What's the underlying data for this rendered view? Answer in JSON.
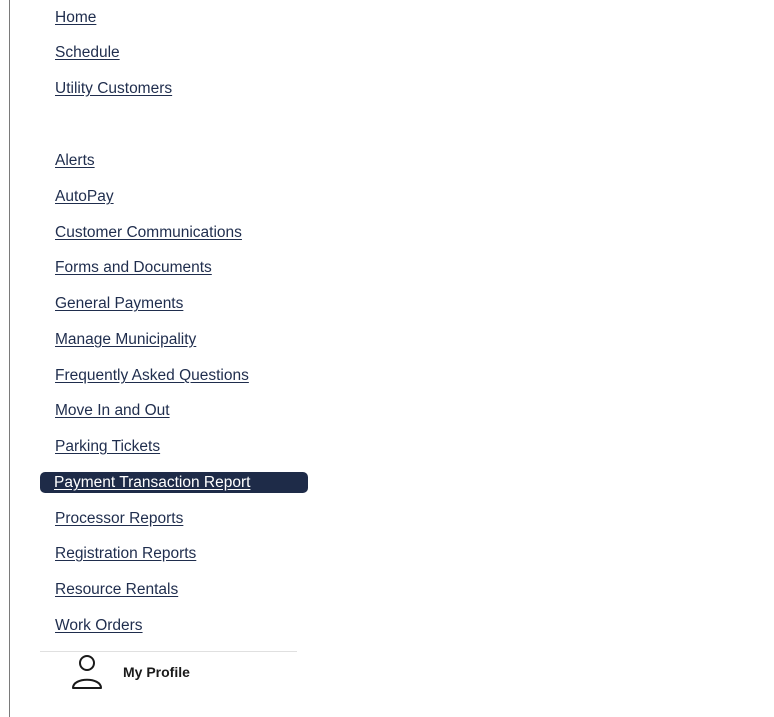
{
  "nav": {
    "items": [
      {
        "label": "Home"
      },
      {
        "label": "Schedule"
      },
      {
        "label": "Utility Customers"
      },
      {
        "label": "Alerts"
      },
      {
        "label": "AutoPay"
      },
      {
        "label": "Customer Communications"
      },
      {
        "label": "Forms and Documents"
      },
      {
        "label": "General Payments"
      },
      {
        "label": "Manage Municipality"
      },
      {
        "label": "Frequently Asked Questions"
      },
      {
        "label": "Move In and Out"
      },
      {
        "label": "Parking Tickets"
      },
      {
        "label": "Payment Transaction Report",
        "active": true
      },
      {
        "label": "Processor Reports"
      },
      {
        "label": "Registration Reports"
      },
      {
        "label": "Resource Rentals"
      },
      {
        "label": "Work Orders"
      }
    ]
  },
  "profile": {
    "label": "My Profile",
    "icon": "user-icon"
  },
  "colors": {
    "link": "#1f2d4d",
    "active_bg": "#1e2b48",
    "active_text": "#ffffff"
  }
}
